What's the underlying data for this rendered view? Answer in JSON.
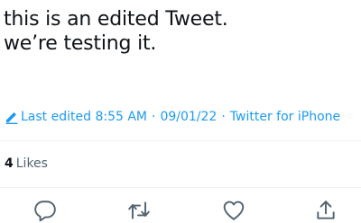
{
  "tweet": {
    "lines": [
      "this is an edited Tweet.",
      "we’re testing it."
    ]
  },
  "meta": {
    "edited_label": "Last edited 8:55 AM",
    "date": "09/01/22",
    "separator": "·",
    "source": "Twitter for iPhone"
  },
  "stats": {
    "likes_count": "4",
    "likes_label": "Likes"
  },
  "actions": [
    {
      "icon": "reply-icon"
    },
    {
      "icon": "retweet-icon"
    },
    {
      "icon": "like-icon"
    },
    {
      "icon": "share-icon"
    }
  ],
  "colors": {
    "text": "#0f1419",
    "link": "#1d9bf0",
    "muted": "#536471",
    "divider": "#eff3f4"
  }
}
